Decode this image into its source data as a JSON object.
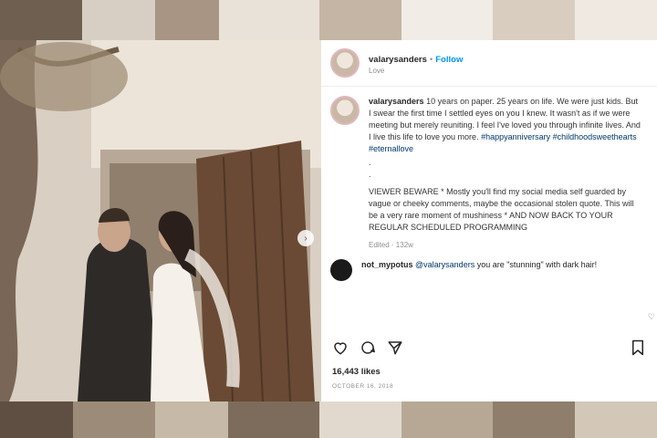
{
  "post": {
    "username": "valarysanders",
    "follow_label": "Follow",
    "location": "Love",
    "caption_user": "valarysanders",
    "caption_p1": "10 years on paper. 25 years on life. We were just kids. But I swear the first time I settled eyes on you I knew. It wasn't as if we were meeting but merely reuniting. I feel I've loved you through infinite lives. And I live this life to love you more.",
    "caption_tags": "#happyanniversary #childhoodsweethearts #eternallove",
    "caption_dots": ".\n.",
    "caption_p2": "VIEWER BEWARE * Mostly you'll find my social media self guarded by vague or cheeky comments, maybe the occasional stolen quote. This will be a very rare moment of mushiness * AND NOW BACK TO YOUR REGULAR SCHEDULED PROGRAMMING",
    "edited": "Edited · 132w",
    "likes": "16,443 likes",
    "date": "OCTOBER 16, 2018"
  },
  "comment": {
    "user": "not_mypotus",
    "mention": "@valarysanders",
    "text": "you are \"stunning\" with dark hair!"
  },
  "colors": {
    "link": "#0095f6",
    "hashtag": "#00376b",
    "text": "#262626",
    "muted": "#8e8e8e"
  },
  "icons": [
    "heart-icon",
    "comment-icon",
    "share-icon",
    "bookmark-icon",
    "chevron-right-icon"
  ]
}
